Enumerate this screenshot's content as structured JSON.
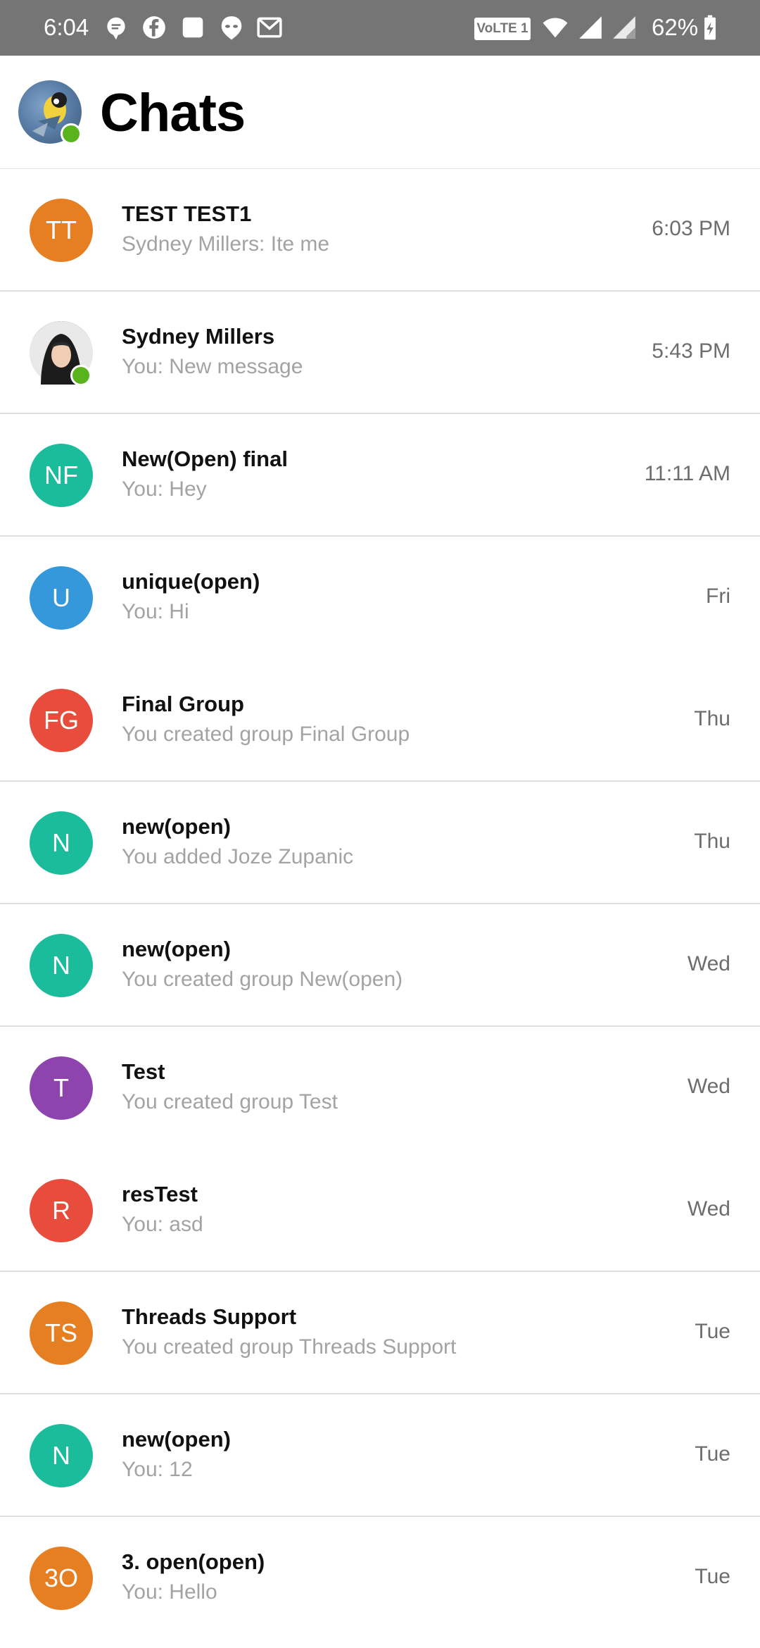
{
  "status_bar": {
    "time": "6:04",
    "network_badge": "VoLTE 1",
    "battery_percent": "62%",
    "icons": [
      "chat-bubble-icon",
      "facebook-icon",
      "square-app-icon",
      "alien-icon",
      "gmail-icon",
      "wifi-icon",
      "signal-icon",
      "signal-roaming-icon",
      "battery-charging-icon"
    ]
  },
  "header": {
    "title": "Chats",
    "avatar_online": true
  },
  "colors": {
    "orange": "#e67e22",
    "teal": "#1abc9c",
    "blue": "#3498db",
    "red": "#e74c3c",
    "purple": "#8e44ad",
    "online": "#58b31c"
  },
  "chats": [
    {
      "initials": "TT",
      "color": "#e67e22",
      "name": "TEST TEST1",
      "preview": "Sydney Millers: Ite me",
      "time": "6:03 PM",
      "photo": false,
      "online": false
    },
    {
      "initials": "",
      "color": "",
      "name": "Sydney Millers",
      "preview": "You: New message",
      "time": "5:43 PM",
      "photo": true,
      "online": true
    },
    {
      "initials": "NF",
      "color": "#1abc9c",
      "name": "New(Open) final",
      "preview": "You: Hey",
      "time": "11:11 AM",
      "photo": false,
      "online": false
    },
    {
      "initials": "U",
      "color": "#3498db",
      "name": "unique(open)",
      "preview": "You: Hi",
      "time": "Fri",
      "photo": false,
      "online": false
    },
    {
      "initials": "FG",
      "color": "#e74c3c",
      "name": "Final Group",
      "preview": "You created group Final Group",
      "time": "Thu",
      "photo": false,
      "online": false
    },
    {
      "initials": "N",
      "color": "#1abc9c",
      "name": "new(open)",
      "preview": "You added Joze Zupanic",
      "time": "Thu",
      "photo": false,
      "online": false
    },
    {
      "initials": "N",
      "color": "#1abc9c",
      "name": "new(open)",
      "preview": "You created group New(open)",
      "time": "Wed",
      "photo": false,
      "online": false
    },
    {
      "initials": "T",
      "color": "#8e44ad",
      "name": "Test",
      "preview": "You created group Test",
      "time": "Wed",
      "photo": false,
      "online": false
    },
    {
      "initials": "R",
      "color": "#e74c3c",
      "name": "resTest",
      "preview": "You: asd",
      "time": "Wed",
      "photo": false,
      "online": false
    },
    {
      "initials": "TS",
      "color": "#e67e22",
      "name": "Threads Support",
      "preview": "You created group Threads Support",
      "time": "Tue",
      "photo": false,
      "online": false
    },
    {
      "initials": "N",
      "color": "#1abc9c",
      "name": "new(open)",
      "preview": "You: 12",
      "time": "Tue",
      "photo": false,
      "online": false
    },
    {
      "initials": "3O",
      "color": "#e67e22",
      "name": "3. open(open)",
      "preview": "You: Hello",
      "time": "Tue",
      "photo": false,
      "online": false
    }
  ]
}
